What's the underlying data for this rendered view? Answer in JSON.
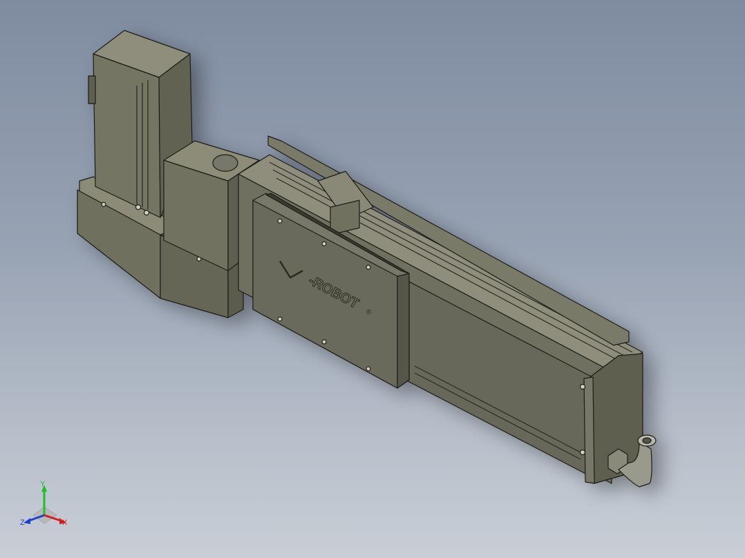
{
  "viewport": {
    "background_top": "#7f8ca0",
    "background_bottom": "#c9ced6"
  },
  "model": {
    "logo_text": "-ROBOT",
    "logo_mark": "®",
    "body_color": "#6f6f60",
    "edge_color": "#1c1c16"
  },
  "triad": {
    "x_label": "X",
    "y_label": "Y",
    "z_label": "Z",
    "x_color": "#d21e1e",
    "y_color": "#1fbf2a",
    "z_color": "#1e3fd2"
  }
}
